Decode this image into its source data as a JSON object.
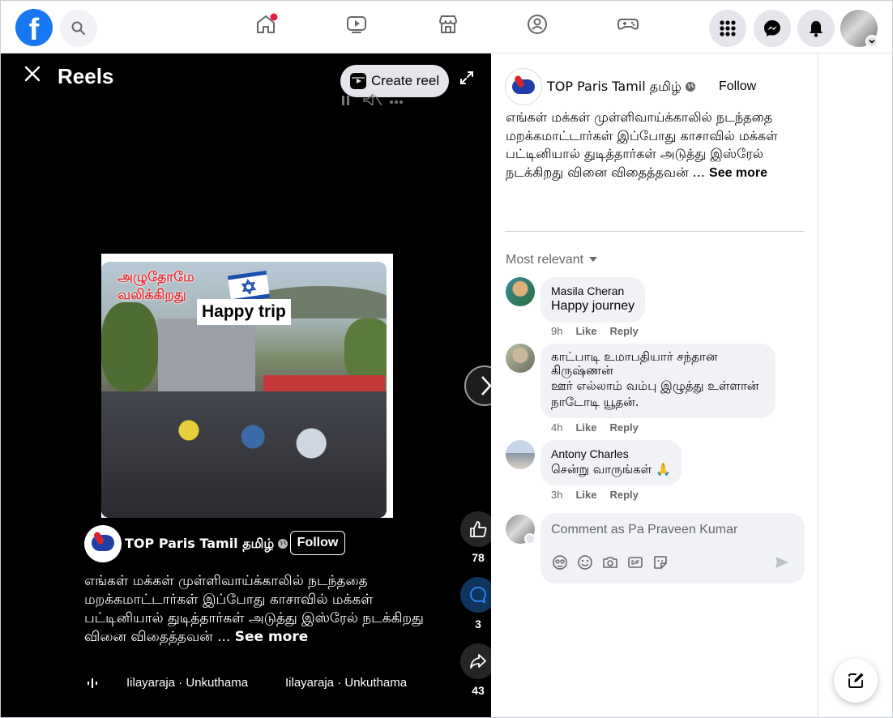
{
  "topbar": {
    "logo_letter": "f",
    "notification_dot_color": "#e41e3f",
    "icons": [
      "facebook-logo",
      "search-icon",
      "home-icon",
      "video-icon",
      "marketplace-icon",
      "groups-icon",
      "gaming-icon",
      "menu-grid-icon",
      "messenger-icon",
      "bell-icon",
      "profile-avatar"
    ]
  },
  "reel": {
    "header_title": "Reels",
    "create_reel_label": "Create reel",
    "video_overlay": {
      "tamil_text": "அழுதோமே வலிக்கிறது",
      "sticker_text": "Happy trip"
    },
    "author_name": "TOP Paris Tamil தமிழ்",
    "follow_label": "Follow",
    "caption": "எங்கள் மக்கள் முள்ளிவாய்க்காலில் நடந்ததை மறக்கமாட்டார்கள் இப்போது காசாவில் மக்கள் பட்டினியால் துடித்தார்கள் அடுத்து இஸ்ரேல் நடக்கிறது வினை விதைத்தவன் ...",
    "see_more": "See more",
    "music_1": "Iilayaraja · Unkuthama",
    "music_2": "Iilayaraja · Unkuthama",
    "likes_count": "78",
    "comments_count": "3",
    "shares_count": "43"
  },
  "post": {
    "author_name": "TOP Paris Tamil தமிழ்",
    "follow_label": "Follow",
    "caption": "எங்கள் மக்கள் முள்ளிவாய்க்காலில் நடந்ததை மறக்கமாட்டார்கள் இப்போது காசாவில் மக்கள் பட்டினியால் துடித்தார்கள் அடுத்து இஸ்ரேல் நடக்கிறது வினை விதைத்தவன் ...",
    "see_more": "See more",
    "sort_label": "Most relevant"
  },
  "comments": [
    {
      "name": "Masila Cheran",
      "text": "Happy journey",
      "time": "9h",
      "like": "Like",
      "reply": "Reply"
    },
    {
      "name": "காட்பாடி உமாபதியார் சந்தான கிருஷ்ணன்",
      "text": "ஊர் எல்லாம் வம்பு இழுத்து உள்ளான் நாடோடி யூதன்.",
      "time": "4h",
      "like": "Like",
      "reply": "Reply"
    },
    {
      "name": "Antony Charles",
      "text": "சென்று வாருங்கள் 🙏",
      "time": "3h",
      "like": "Like",
      "reply": "Reply"
    }
  ],
  "composer": {
    "placeholder": "Comment as Pa Praveen Kumar",
    "tools": [
      "avatar-sticker-icon",
      "emoji-icon",
      "camera-icon",
      "gif-icon",
      "sticker-icon",
      "send-icon"
    ]
  },
  "colors": {
    "brand_blue": "#1877f2",
    "bubble_bg": "#f0f2f5",
    "muted_text": "#65676b"
  }
}
